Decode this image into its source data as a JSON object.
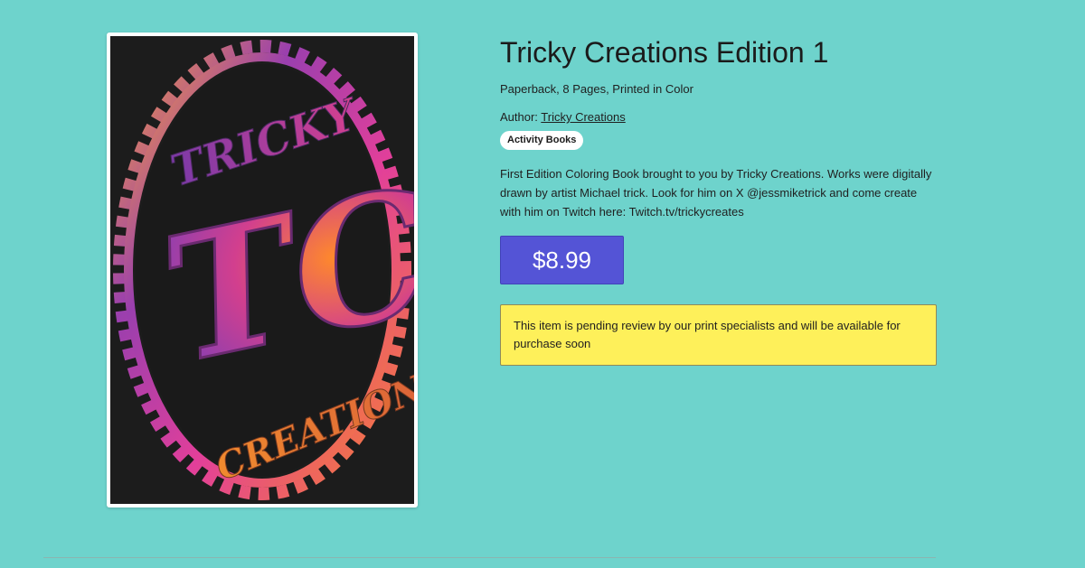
{
  "product": {
    "title": "Tricky Creations Edition 1",
    "format": "Paperback, 8 Pages, Printed in Color",
    "author_prefix": "Author: ",
    "author_name": "Tricky Creations",
    "category": "Activity Books",
    "description": "First Edition Coloring Book brought to you by Tricky Creations. Works were digitally drawn by artist Michael trick. Look for him on X @jessmiketrick and come create with him on Twitch here: Twitch.tv/trickycreates",
    "price": "$8.99",
    "notice": "This item is pending review by our print specialists and will be available for purchase soon"
  },
  "cover": {
    "logo_top_text": "TRICKY",
    "logo_monogram": "TC",
    "logo_bottom_text": "CREATIONS"
  },
  "colors": {
    "page_background": "#6ed3cc",
    "price_button": "#5454d6",
    "notice_background": "#fef05a",
    "badge_background": "#ffffff"
  }
}
